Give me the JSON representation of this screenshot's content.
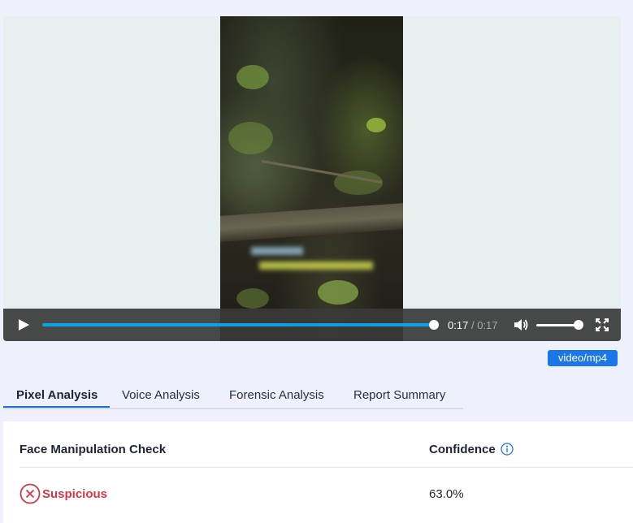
{
  "player": {
    "current_time": "0:17",
    "separator": "/",
    "duration": "0:17",
    "progress_fraction": 1.0,
    "volume_fraction": 1.0,
    "icons": [
      "play-icon",
      "volume-icon",
      "fullscreen-icon"
    ]
  },
  "mime_type": "video/mp4",
  "tabs": [
    {
      "label": "Pixel Analysis",
      "active": true
    },
    {
      "label": "Voice Analysis",
      "active": false
    },
    {
      "label": "Forensic Analysis",
      "active": false
    },
    {
      "label": "Report Summary",
      "active": false
    }
  ],
  "results": {
    "header_check": "Face Manipulation Check",
    "header_confidence": "Confidence",
    "rows": [
      {
        "status": "Suspicious",
        "confidence": "63.0%"
      }
    ]
  },
  "colors": {
    "accent": "#1b76e8",
    "progress": "#0aa3e6",
    "suspicious": "#d93447"
  }
}
